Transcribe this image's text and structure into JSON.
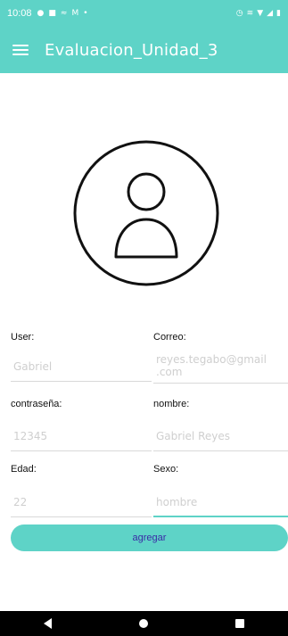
{
  "status_bar": {
    "time": "10:08",
    "left_icons": [
      "facebook-icon",
      "youtube-icon",
      "wave-icon",
      "gmail-icon",
      "dot-icon"
    ],
    "right_icons": [
      "alarm-icon",
      "signal-icon",
      "wifi-icon",
      "cell-signal-icon",
      "battery-icon"
    ]
  },
  "app_bar": {
    "title": "Evaluacion_Unidad_3",
    "menu_icon": "hamburger-menu-icon"
  },
  "avatar": {
    "icon": "user-profile-icon"
  },
  "form": {
    "user": {
      "label": "User:",
      "value": "Gabriel"
    },
    "correo": {
      "label": "Correo:",
      "value": "reyes.tegabo@gmail\n.com"
    },
    "password": {
      "label": "contraseña:",
      "value": "12345"
    },
    "nombre": {
      "label": "nombre:",
      "value": "Gabriel Reyes"
    },
    "edad": {
      "label": "Edad:",
      "value": "22"
    },
    "sexo": {
      "label": "Sexo:",
      "value": "hombre"
    }
  },
  "actions": {
    "add_label": "agregar"
  },
  "colors": {
    "accent": "#5ed3c7",
    "button_text": "#3a2aa6",
    "placeholder_text": "#cfcfcf"
  },
  "nav_bar": {
    "icons": [
      "back-icon",
      "home-icon",
      "recents-icon"
    ]
  }
}
